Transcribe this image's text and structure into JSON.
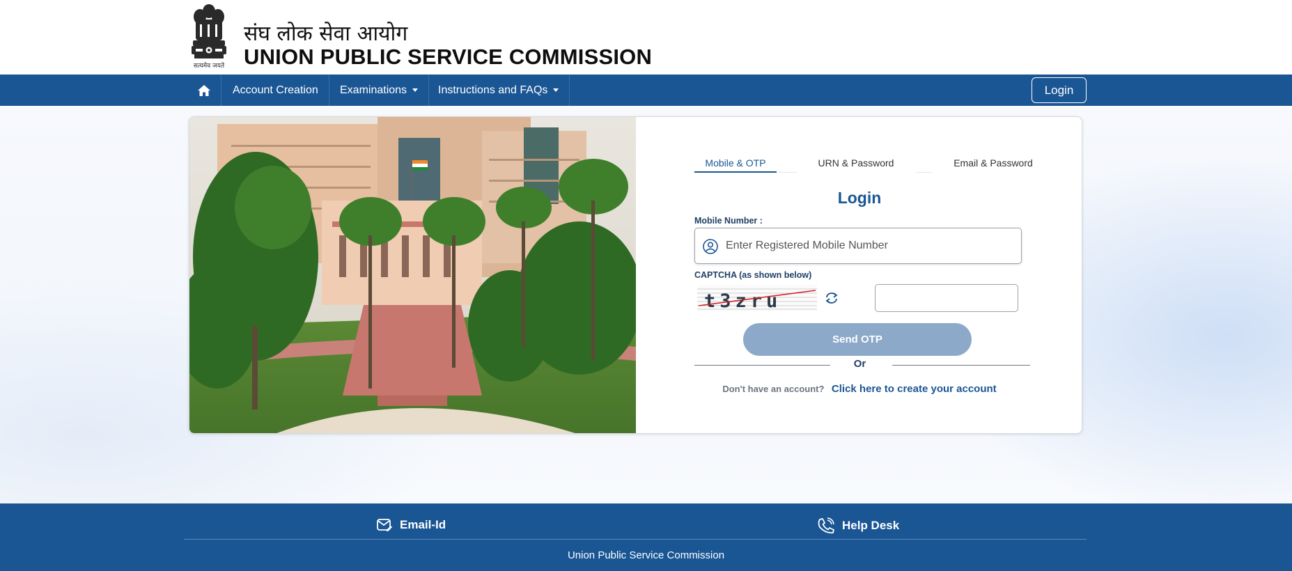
{
  "header": {
    "emblem_caption": "सत्यमेव जयते",
    "title_hindi": "संघ लोक सेवा आयोग",
    "title_english": "UNION PUBLIC SERVICE COMMISSION"
  },
  "navbar": {
    "home_icon": "home-icon",
    "items": [
      {
        "label": "Account Creation",
        "dropdown": false
      },
      {
        "label": "Examinations",
        "dropdown": true
      },
      {
        "label": "Instructions and FAQs",
        "dropdown": true
      }
    ],
    "login_label": "Login"
  },
  "login_form": {
    "tabs": [
      {
        "label": "Mobile & OTP",
        "active": true
      },
      {
        "label": "URN & Password",
        "active": false
      },
      {
        "label": "Email & Password",
        "active": false
      }
    ],
    "title": "Login",
    "mobile_label": "Mobile Number :",
    "mobile_placeholder": "Enter Registered Mobile Number",
    "captcha_label": "CAPTCHA (as shown below)",
    "captcha_text": "t3zru",
    "captcha_input_value": "",
    "send_otp_label": "Send OTP",
    "or_label": "Or",
    "signup_question": "Don't have an account?",
    "signup_link": "Click here to create your account"
  },
  "footer": {
    "email_label": "Email-Id",
    "helpdesk_label": "Help Desk",
    "copyright": "Union Public Service Commission"
  },
  "colors": {
    "primary": "#1a5694",
    "button_disabled": "#8ca9c9",
    "title_blue": "#1a5694"
  }
}
